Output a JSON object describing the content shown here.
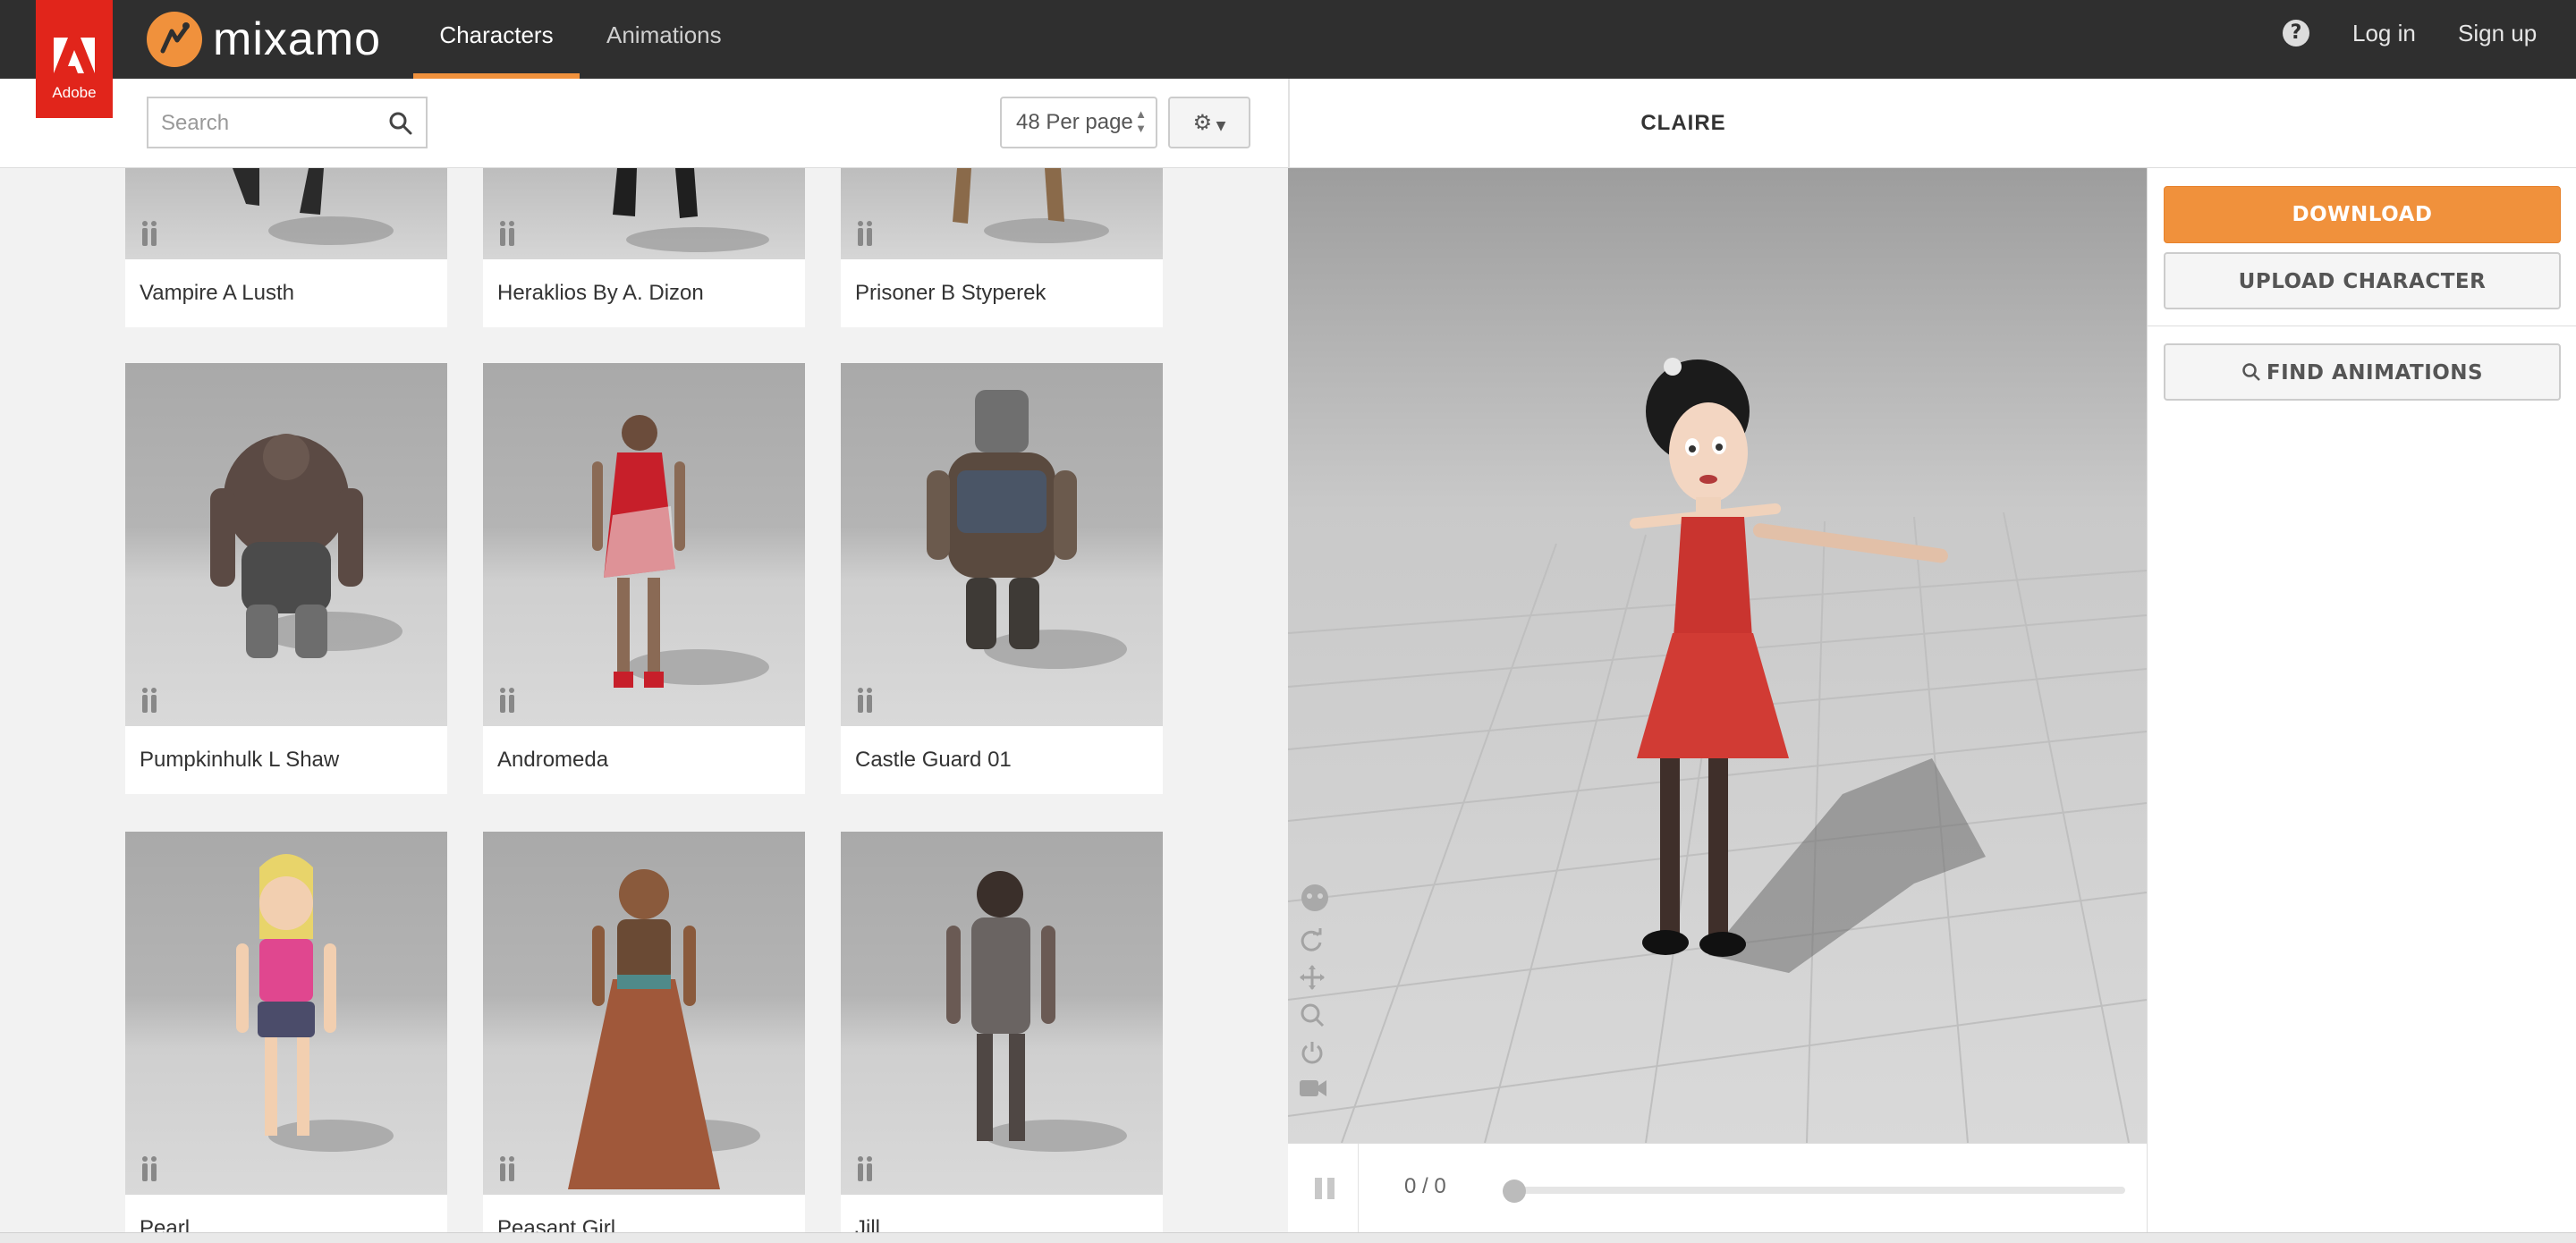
{
  "header": {
    "adobe_label": "Adobe",
    "brand": "mixamo",
    "tabs": [
      {
        "label": "Characters",
        "active": true
      },
      {
        "label": "Animations",
        "active": false
      }
    ],
    "help_icon": "question-circle-icon",
    "login": "Log in",
    "signup": "Sign up",
    "accent_color": "#f0913c"
  },
  "toolbar": {
    "search_placeholder": "Search",
    "search_value": "",
    "per_page": "48 Per page",
    "settings_icon": "gear-icon"
  },
  "characters": [
    {
      "name": "Vampire A Lusth"
    },
    {
      "name": "Heraklios By A. Dizon"
    },
    {
      "name": "Prisoner B Styperek"
    },
    {
      "name": "Pumpkinhulk L Shaw"
    },
    {
      "name": "Andromeda"
    },
    {
      "name": "Castle Guard 01"
    },
    {
      "name": "Pearl"
    },
    {
      "name": "Peasant Girl"
    },
    {
      "name": "Jill"
    }
  ],
  "viewer": {
    "character_name": "CLAIRE",
    "frame_counter": "0 / 0",
    "progress": 0
  },
  "actions": {
    "download": "DOWNLOAD",
    "upload": "UPLOAD CHARACTER",
    "find_animations": "FIND ANIMATIONS"
  }
}
